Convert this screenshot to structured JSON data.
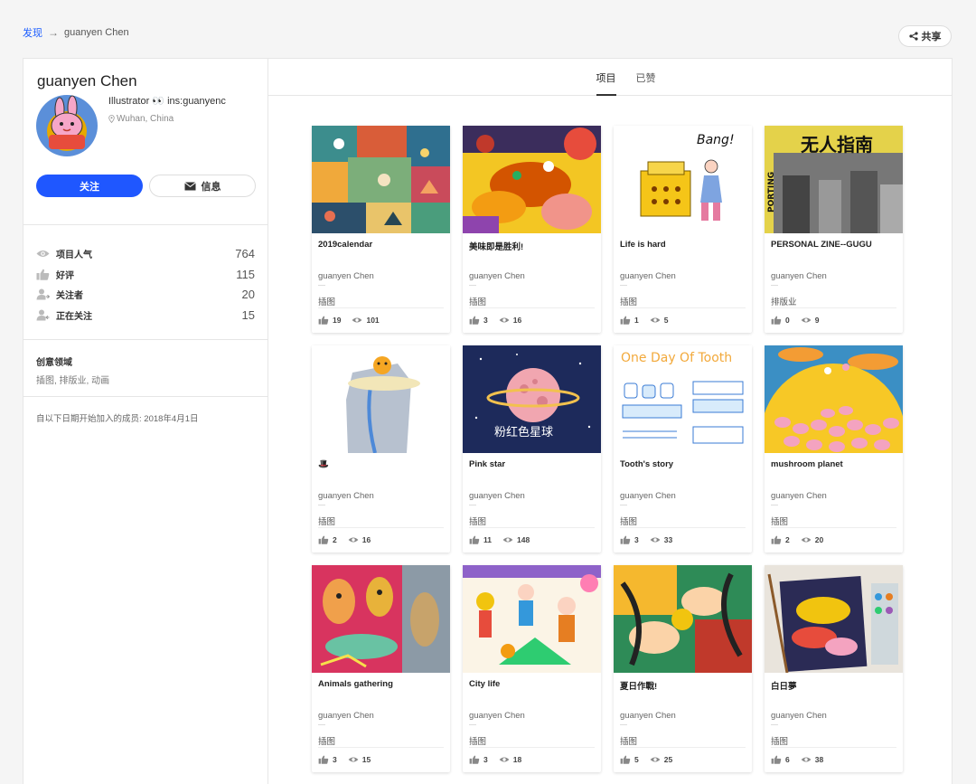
{
  "breadcrumb": {
    "discover": "发现",
    "arrow": "→",
    "current": "guanyen Chen"
  },
  "share": {
    "label": "共享"
  },
  "profile": {
    "name": "guanyen Chen",
    "bio_prefix": "Illustrator",
    "bio_eyes": "👀",
    "bio_suffix": "ins:guanyenc",
    "location": "Wuhan, China",
    "follow_label": "关注",
    "message_label": "信息"
  },
  "stats": [
    {
      "icon": "eye-icon",
      "label": "项目人气",
      "value": "764"
    },
    {
      "icon": "thumbs-up-icon",
      "label": "好评",
      "value": "115"
    },
    {
      "icon": "user-followers-icon",
      "label": "关注者",
      "value": "20"
    },
    {
      "icon": "user-following-icon",
      "label": "正在关注",
      "value": "15"
    }
  ],
  "creative_fields": {
    "title": "创意领域",
    "value": "插图, 排版业, 动画"
  },
  "member_since": "自以下日期开始加入的成员: 2018年4月1日",
  "tabs": [
    {
      "label": "项目",
      "active": true
    },
    {
      "label": "已赞",
      "active": false
    }
  ],
  "projects": [
    {
      "title": "2019calendar",
      "owner": "guanyen Chen",
      "category": "插图",
      "likes": "19",
      "views": "101"
    },
    {
      "title": "美味即是胜利!",
      "owner": "guanyen Chen",
      "category": "插图",
      "likes": "3",
      "views": "16"
    },
    {
      "title": "Life is hard",
      "owner": "guanyen Chen",
      "category": "插图",
      "likes": "1",
      "views": "5"
    },
    {
      "title": "PERSONAL ZINE--GUGU",
      "owner": "guanyen Chen",
      "category": "排版业",
      "likes": "0",
      "views": "9"
    },
    {
      "title": "🎩",
      "owner": "guanyen Chen",
      "category": "插图",
      "likes": "2",
      "views": "16"
    },
    {
      "title": "Pink star",
      "owner": "guanyen Chen",
      "category": "插图",
      "likes": "11",
      "views": "148"
    },
    {
      "title": "Tooth's story",
      "owner": "guanyen Chen",
      "category": "插图",
      "likes": "3",
      "views": "33"
    },
    {
      "title": "mushroom planet",
      "owner": "guanyen Chen",
      "category": "插图",
      "likes": "2",
      "views": "20"
    },
    {
      "title": "Animals gathering",
      "owner": "guanyen Chen",
      "category": "插图",
      "likes": "3",
      "views": "15"
    },
    {
      "title": "City life",
      "owner": "guanyen Chen",
      "category": "插图",
      "likes": "3",
      "views": "18"
    },
    {
      "title": "夏日作戰!",
      "owner": "guanyen Chen",
      "category": "插图",
      "likes": "5",
      "views": "25"
    },
    {
      "title": "白日夢",
      "owner": "guanyen Chen",
      "category": "插图",
      "likes": "6",
      "views": "38"
    }
  ],
  "thumb_text": {
    "bang": "Bang!",
    "zine_cn": "无人指南",
    "zine_side": "PORTING",
    "pink_star_cn": "粉红色星球",
    "tooth_title": "One Day Of Tooth"
  },
  "colors": {
    "accent": "#1f57ff",
    "text_dark": "#222222",
    "text_muted": "#777777"
  }
}
